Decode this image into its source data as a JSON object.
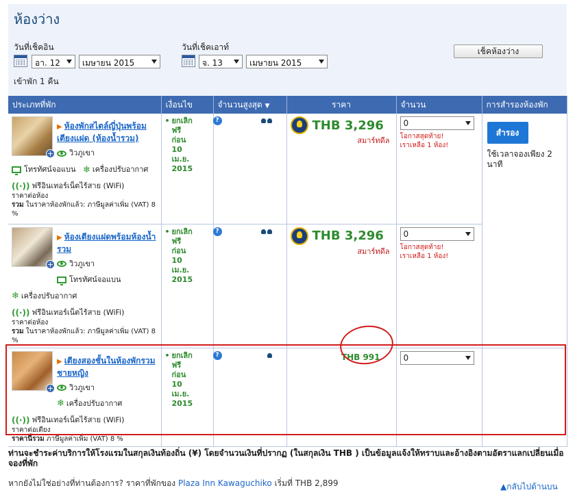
{
  "title": "ห้องว่าง",
  "checkin": {
    "label": "วันที่เช็คอิน",
    "day": "อา. 12",
    "month": "เมษายน 2015"
  },
  "checkout": {
    "label": "วันที่เช็คเอาท์",
    "day": "จ. 13",
    "month": "เมษายน 2015"
  },
  "check_button": "เช็คห้องว่าง",
  "nights": "เข้าพัก 1 คืน",
  "columns": {
    "type": "ประเภทที่พัก",
    "condition": "เงื่อนไข",
    "max": "จำนวนสูงสุด",
    "price": "ราคา",
    "quantity": "จำนวน",
    "booking": "การสำรองห้องพัก"
  },
  "rooms": [
    {
      "name": "ห้องพักสไตล์ญี่ปุ่นพร้อมเตียงแฝด (ห้องน้ำรวม)",
      "features": [
        "วิวภูเขา",
        "โทรทัศน์จอแบน",
        "เครื่องปรับอากาศ",
        "ฟรีอินเทอร์เน็ตไร้สาย (WiFi)"
      ],
      "price_note1": "ราคาต่อห้อง",
      "price_note2_bold": "รวม",
      "price_note2": " ในราคาห้องพักแล้ว: ภาษีมูลค่าเพิ่ม (VAT) 8 %",
      "condition": [
        "ยกเลิก",
        "ฟรี",
        "ก่อน",
        "10",
        "เม.ย.",
        "2015"
      ],
      "price": "THB 3,296",
      "deal": "สมาร์ทดีล",
      "qty": "0",
      "warn1": "โอกาสสุดท้าย!",
      "warn2": "เราเหลือ 1 ห้อง!"
    },
    {
      "name": "ห้องเตียงแฝดพร้อมห้องน้ำรวม",
      "features": [
        "วิวภูเขา",
        "โทรทัศน์จอแบน",
        "เครื่องปรับอากาศ",
        "ฟรีอินเทอร์เน็ตไร้สาย (WiFi)"
      ],
      "price_note1": "ราคาต่อห้อง",
      "price_note2_bold": "รวม",
      "price_note2": " ในราคาห้องพักแล้ว: ภาษีมูลค่าเพิ่ม (VAT) 8 %",
      "condition": [
        "ยกเลิก",
        "ฟรี",
        "ก่อน",
        "10",
        "เม.ย.",
        "2015"
      ],
      "price": "THB 3,296",
      "deal": "สมาร์ทดีล",
      "qty": "0",
      "warn1": "โอกาสสุดท้าย!",
      "warn2": "เราเหลือ 1 ห้อง!"
    },
    {
      "name": "เตียงสองชั้นในห้องพักรวมชายหญิง",
      "features": [
        "วิวภูเขา",
        "เครื่องปรับอากาศ",
        "ฟรีอินเทอร์เน็ตไร้สาย (WiFi)"
      ],
      "price_note1": "ราคาต่อเตียง",
      "price_note2_bold": "ราคานี้รวม",
      "price_note2": " ภาษีมูลค่าเพิ่ม (VAT) 8 %",
      "condition": [
        "ยกเลิก",
        "ฟรี",
        "ก่อน",
        "10",
        "เม.ย.",
        "2015"
      ],
      "price": "THB 991",
      "qty": "0"
    }
  ],
  "reserve": {
    "button": "สำรอง",
    "note": "ใช้เวลาจองเพียง 2 นาที"
  },
  "footer": {
    "currency_note": "ท่านจะชำระค่าบริการให้โรงแรมในสกุลเงินท้องถิ่น (¥) โดยจำนวนเงินที่ปรากฏ (ในสกุลเงิน THB ) เป็นข้อมูลแจ้งให้ทราบและอ้างอิงตามอัตราแลกเปลี่ยนเมื่อจองที่พัก",
    "other_prefix": "หากยังไม่ใช่อย่างที่ท่านต้องการ? ราคาที่พักของ ",
    "hotel_link": "Plaza Inn Kawaguchiko",
    "other_suffix": " เริ่มที่ THB 2,899",
    "back_to_top": "▲กลับไปด้านบน"
  },
  "colors": {
    "header_bg": "#3d6ab1",
    "price_green": "#2e8b2e",
    "warning_red": "#d11a1a",
    "link_blue": "#1a66c9"
  }
}
